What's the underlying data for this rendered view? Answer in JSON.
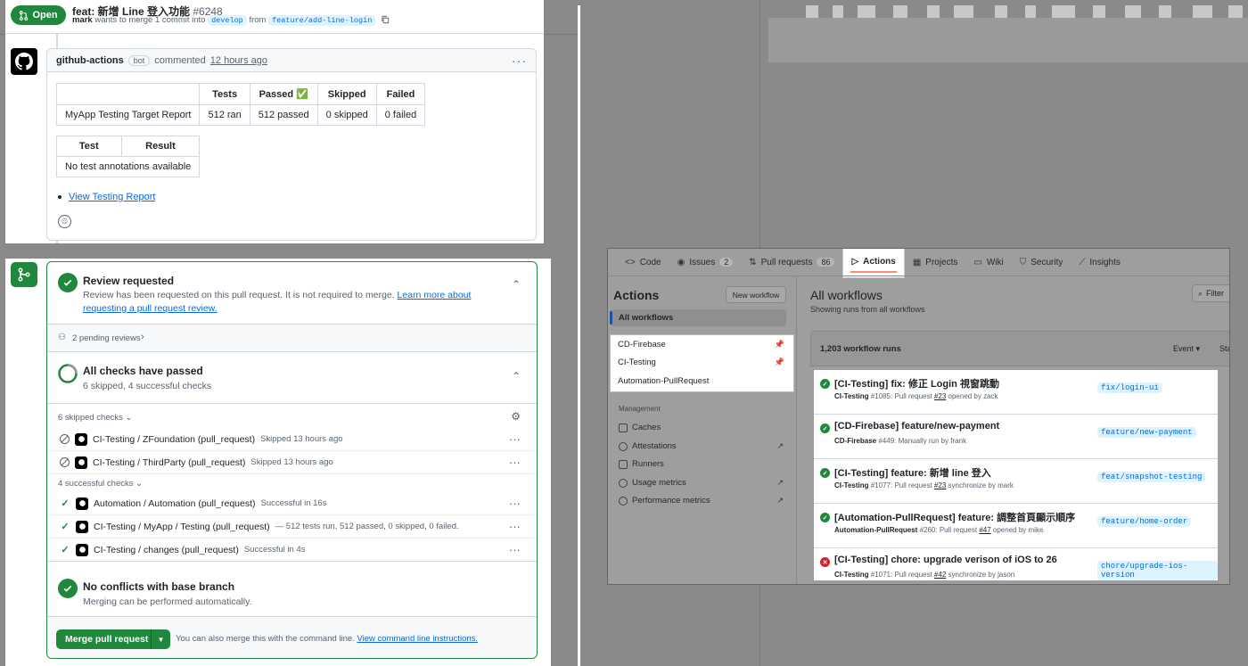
{
  "pr": {
    "status_label": "Open",
    "title": "feat: 新增 Line 登入功能",
    "number": "#6248",
    "author": "mark",
    "merge_text": "wants to merge 1 commit into",
    "base_branch": "develop",
    "from_text": "from",
    "head_branch": "feature/add-line-login"
  },
  "comment": {
    "author": "github-actions",
    "bot_tag": "bot",
    "action": "commented",
    "time": "12 hours ago",
    "summary_table": {
      "headers": [
        "",
        "Tests",
        "Passed ✅",
        "Skipped",
        "Failed"
      ],
      "row": [
        "MyApp Testing Target Report",
        "512 ran",
        "512 passed",
        "0 skipped",
        "0 failed"
      ]
    },
    "annotation_table": {
      "headers": [
        "Test",
        "Result"
      ],
      "row": [
        "No test annotations available"
      ]
    },
    "report_link": "View Testing Report"
  },
  "merge": {
    "review_title": "Review requested",
    "review_desc": "Review has been requested on this pull request. It is not required to merge.",
    "review_link": "Learn more about requesting a pull request review.",
    "pending_reviews": "2 pending reviews",
    "checks_title": "All checks have passed",
    "checks_desc": "6 skipped, 4 successful checks",
    "skipped_label": "6 skipped checks",
    "successful_label": "4 successful checks",
    "skipped_checks": [
      {
        "name": "CI-Testing / ZFoundation (pull_request)",
        "status": "Skipped 13 hours ago"
      },
      {
        "name": "CI-Testing / ThirdParty (pull_request)",
        "status": "Skipped 13 hours ago"
      }
    ],
    "successful_checks": [
      {
        "name": "Automation / Automation (pull_request)",
        "status": "Successful in 16s"
      },
      {
        "name": "CI-Testing / MyApp / Testing (pull_request)",
        "status": "— 512 tests run, 512 passed, 0 skipped, 0 failed."
      },
      {
        "name": "CI-Testing / changes (pull_request)",
        "status": "Successful in 4s"
      }
    ],
    "conflict_title": "No conflicts with base branch",
    "conflict_desc": "Merging can be performed automatically.",
    "merge_button": "Merge pull request",
    "cli_hint": "You can also merge this with the command line.",
    "cli_link": "View command line instructions."
  },
  "actions": {
    "nav": [
      {
        "label": "Code",
        "icon": "code-icon",
        "count": ""
      },
      {
        "label": "Issues",
        "icon": "issue-icon",
        "count": "2"
      },
      {
        "label": "Pull requests",
        "icon": "pull-request-icon",
        "count": "86"
      },
      {
        "label": "Actions",
        "icon": "play-icon",
        "count": ""
      },
      {
        "label": "Projects",
        "icon": "table-icon",
        "count": ""
      },
      {
        "label": "Wiki",
        "icon": "book-icon",
        "count": ""
      },
      {
        "label": "Security",
        "icon": "shield-icon",
        "count": ""
      },
      {
        "label": "Insights",
        "icon": "graph-icon",
        "count": ""
      }
    ],
    "sidebar_title": "Actions",
    "new_workflow": "New workflow",
    "all_workflows": "All workflows",
    "workflows": [
      "CD-Firebase",
      "CI-Testing",
      "Automation-PullRequest"
    ],
    "management_label": "Management",
    "management": [
      "Caches",
      "Attestations",
      "Runners",
      "Usage metrics",
      "Performance metrics"
    ],
    "main_title": "All workflows",
    "main_sub": "Showing runs from all workflows",
    "filter": "Filter",
    "runs_count": "1,203 workflow runs",
    "event_label": "Event",
    "status_label": "Sta",
    "runs": [
      {
        "title": "[CI-Testing] fix: 修正 Login 視窗跳動",
        "workflow": "CI-Testing",
        "detail": "#1085: Pull request",
        "pr": "#23",
        "after": "opened by zack",
        "branch": "fix/login-ui",
        "status": "success"
      },
      {
        "title": "[CD-Firebase] feature/new-payment",
        "workflow": "CD-Firebase",
        "detail": "#449: Manually run by frank",
        "pr": "",
        "after": "",
        "branch": "feature/new-payment",
        "status": "success"
      },
      {
        "title": "[CI-Testing] feature: 新增 line 登入",
        "workflow": "CI-Testing",
        "detail": "#1077: Pull request",
        "pr": "#23",
        "after": "synchronize by mark",
        "branch": "feat/snapshot-testing",
        "status": "success"
      },
      {
        "title": "[Automation-PullRequest] feature: 調整首頁顯示順序",
        "workflow": "Automation-PullRequest",
        "detail": "#260: Pull request",
        "pr": "#47",
        "after": "opened by mike",
        "branch": "feature/home-order",
        "status": "success"
      },
      {
        "title": "[CI-Testing] chore: upgrade verison of iOS to 26",
        "workflow": "CI-Testing",
        "detail": "#1071: Pull request",
        "pr": "#42",
        "after": "synchronize by jason",
        "branch": "chore/upgrade-ios-version",
        "status": "failure"
      }
    ],
    "colors": {
      "success": "#1f883d",
      "failure": "#cf222e",
      "accent": "#fd8c73"
    }
  }
}
